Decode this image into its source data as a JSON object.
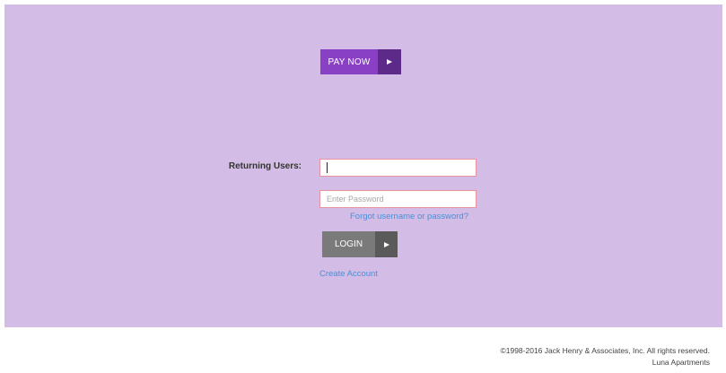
{
  "pay": {
    "label": "PAY NOW",
    "color": "#8a40c4",
    "arrow_color": "#5d2a8a"
  },
  "login_form": {
    "returning_users_label": "Returning Users:",
    "username": {
      "value": "",
      "placeholder": ""
    },
    "password": {
      "value": "",
      "placeholder": "Enter Password"
    },
    "forgot_link": "Forgot username or password?",
    "login_label": "LOGIN",
    "create_account_link": "Create Account"
  },
  "footer": {
    "copyright": "©1998-2016 Jack Henry & Associates, Inc. All rights reserved.",
    "company": "Luna Apartments"
  },
  "colors": {
    "panel_background": "#d3bde6",
    "link": "#4a8fd6",
    "field_border": "#e8939e"
  },
  "icons": {
    "pay_arrow": "play-arrow-icon",
    "login_arrow": "play-arrow-icon"
  }
}
